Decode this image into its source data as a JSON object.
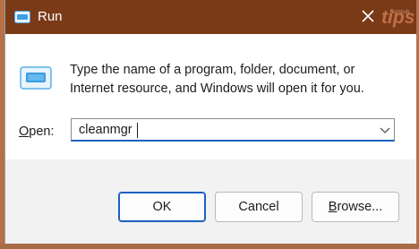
{
  "window": {
    "title": "Run",
    "watermark": "tips",
    "watermark_small": "techhub"
  },
  "dialog": {
    "description": "Type the name of a program, folder, document, or Internet resource, and Windows will open it for you.",
    "open_label": "Open:",
    "open_value": "cleanmgr"
  },
  "buttons": {
    "ok": "OK",
    "cancel": "Cancel",
    "browse": "Browse..."
  },
  "icons": {
    "app": "run-icon",
    "close": "close-icon",
    "dropdown": "chevron-down-icon"
  },
  "colors": {
    "titlebar": "#7a3a18",
    "accent": "#1b5fc0",
    "footer": "#f2f2f2"
  }
}
